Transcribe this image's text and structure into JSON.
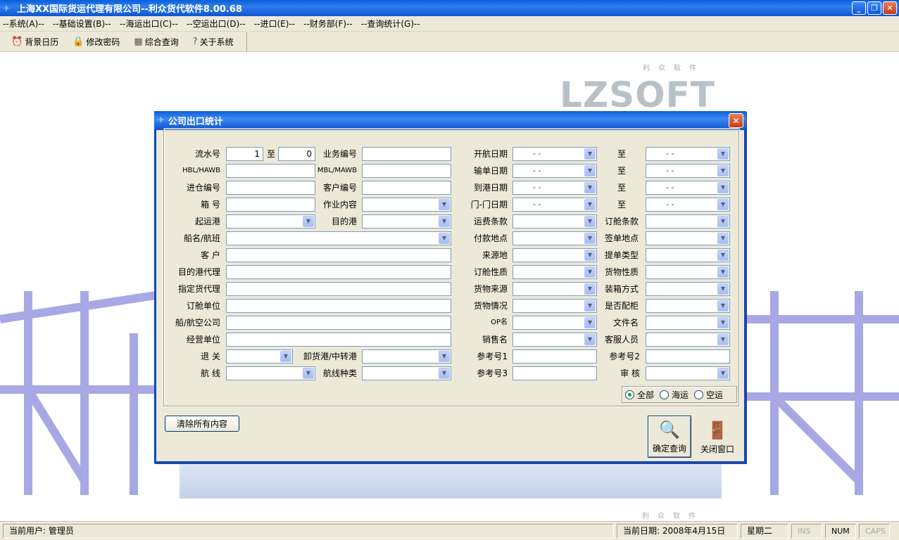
{
  "window": {
    "title": "上海XX国际货运代理有限公司--利众货代软件8.00.68"
  },
  "menu": [
    "--系统(A)--",
    "--基础设置(B)--",
    "--海运出口(C)--",
    "--空运出口(D)--",
    "--进口(E)--",
    "--财务部(F)--",
    "--查询统计(G)--"
  ],
  "toolbar": {
    "calendar": "背景日历",
    "password": "修改密码",
    "query": "综合查询",
    "about": "关于系统"
  },
  "logo": {
    "text": "LZSOFT",
    "small": "利众软件"
  },
  "dialog": {
    "title": "公司出口统计",
    "labels": {
      "serial": "流水号",
      "to": "至",
      "biz_no": "业务编号",
      "sail_date": "开航日期",
      "hbl": "HBL/HAWB",
      "mbl": "MBL/MAWB",
      "input_date": "输单日期",
      "warehouse_no": "进仓编号",
      "cust_no": "客户编号",
      "arrive_date": "到港日期",
      "box_no": "箱 号",
      "job": "作业内容",
      "door_date": "门-门日期",
      "pol": "起运港",
      "pod": "目的港",
      "freight_term": "运费条款",
      "booking_term": "订舱条款",
      "vessel": "船名/航班",
      "pay_place": "付款地点",
      "sign_place": "签单地点",
      "customer": "客 户",
      "source": "来源地",
      "bl_type": "提单类型",
      "dest_agent": "目的港代理",
      "booking_nature": "订舱性质",
      "cargo_nature": "货物性质",
      "assign_agent": "指定货代理",
      "cargo_source": "货物来源",
      "loading": "装箱方式",
      "booking_unit": "订舱单位",
      "cargo_status": "货物情况",
      "stowage": "是否配柜",
      "carrier": "船/航空公司",
      "op": "OP名",
      "file": "文件名",
      "operator": "经营单位",
      "sales": "销售名",
      "cs": "客服人员",
      "customs": "退 关",
      "transit": "卸货港/中转港",
      "ref1": "参考号1",
      "ref2": "参考号2",
      "route": "航 线",
      "route_type": "航线种类",
      "ref3": "参考号3",
      "audit": "审 核"
    },
    "values": {
      "serial_from": "1",
      "serial_to": "0",
      "date_blank": "-  -"
    },
    "radios": {
      "all": "全部",
      "sea": "海运",
      "air": "空运",
      "selected": "all"
    },
    "buttons": {
      "clear": "清除所有内容",
      "ok": "确定查询",
      "close": "关闭窗口"
    }
  },
  "status": {
    "user": "当前用户: 管理员",
    "date": "当前日期: 2008年4月15日",
    "weekday": "星期二",
    "ins": "INS",
    "num": "NUM",
    "caps": "CAPS"
  }
}
